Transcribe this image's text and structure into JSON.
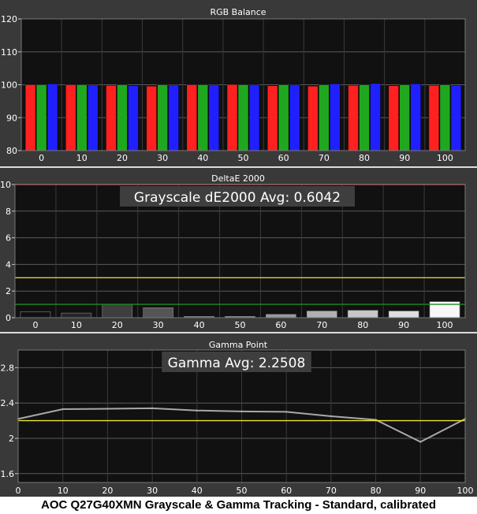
{
  "chart_data": [
    {
      "type": "bar",
      "title": "RGB Balance",
      "xlabel": "",
      "ylabel": "",
      "ylim": [
        80,
        120
      ],
      "yticks": [
        80,
        90,
        100,
        110,
        120
      ],
      "categories": [
        "0",
        "10",
        "20",
        "30",
        "40",
        "50",
        "60",
        "70",
        "80",
        "90",
        "100"
      ],
      "series": [
        {
          "color": "#ff2020",
          "values": [
            100.0,
            100.0,
            99.8,
            99.6,
            100.0,
            100.1,
            99.7,
            99.6,
            99.8,
            99.7,
            99.8
          ]
        },
        {
          "color": "#1fa81f",
          "values": [
            100.0,
            100.0,
            100.0,
            100.0,
            100.0,
            100.0,
            100.0,
            100.0,
            100.0,
            100.0,
            100.0
          ]
        },
        {
          "color": "#2020ff",
          "values": [
            100.3,
            99.9,
            99.7,
            99.9,
            99.9,
            100.0,
            100.0,
            100.3,
            100.4,
            100.3,
            99.8
          ]
        }
      ]
    },
    {
      "type": "bar",
      "title": "DeltaE 2000",
      "annotation": "Grayscale dE2000 Avg: 0.6042",
      "xlabel": "",
      "ylabel": "",
      "ylim": [
        0,
        10
      ],
      "yticks": [
        0,
        2,
        4,
        6,
        8,
        10
      ],
      "categories": [
        "0",
        "10",
        "20",
        "30",
        "40",
        "50",
        "60",
        "70",
        "80",
        "90",
        "100"
      ],
      "values": [
        0.45,
        0.35,
        1.0,
        0.75,
        0.1,
        0.1,
        0.25,
        0.5,
        0.55,
        0.5,
        1.2
      ],
      "bar_colors": [
        "#101010",
        "#262626",
        "#3e3e3e",
        "#555555",
        "#6b6b6b",
        "#828282",
        "#999999",
        "#b0b0b0",
        "#c7c7c7",
        "#dedede",
        "#f7f7f7"
      ],
      "reference_lines": [
        {
          "value": 10,
          "color": "#e04040"
        },
        {
          "value": 3,
          "color": "#d8d820"
        },
        {
          "value": 1,
          "color": "#1f8a1f"
        }
      ]
    },
    {
      "type": "line",
      "title": "Gamma Point",
      "annotation": "Gamma Avg: 2.2508",
      "xlabel": "",
      "ylabel": "",
      "xlim": [
        0,
        100
      ],
      "ylim": [
        1.5,
        3.0
      ],
      "yticks": [
        1.6,
        2.0,
        2.4,
        2.8
      ],
      "xticks": [
        0,
        10,
        20,
        30,
        40,
        50,
        60,
        70,
        80,
        90,
        100
      ],
      "series": [
        {
          "color": "#a8a8a8",
          "x": [
            0,
            10,
            20,
            30,
            40,
            50,
            60,
            70,
            80,
            90,
            100
          ],
          "values": [
            2.22,
            2.33,
            2.335,
            2.34,
            2.315,
            2.305,
            2.3,
            2.25,
            2.21,
            1.96,
            2.22
          ]
        }
      ],
      "reference_lines": [
        {
          "value": 2.2,
          "color": "#e8e830"
        }
      ]
    }
  ],
  "caption": "AOC Q27G40XMN Grayscale & Gamma Tracking - Standard, calibrated"
}
